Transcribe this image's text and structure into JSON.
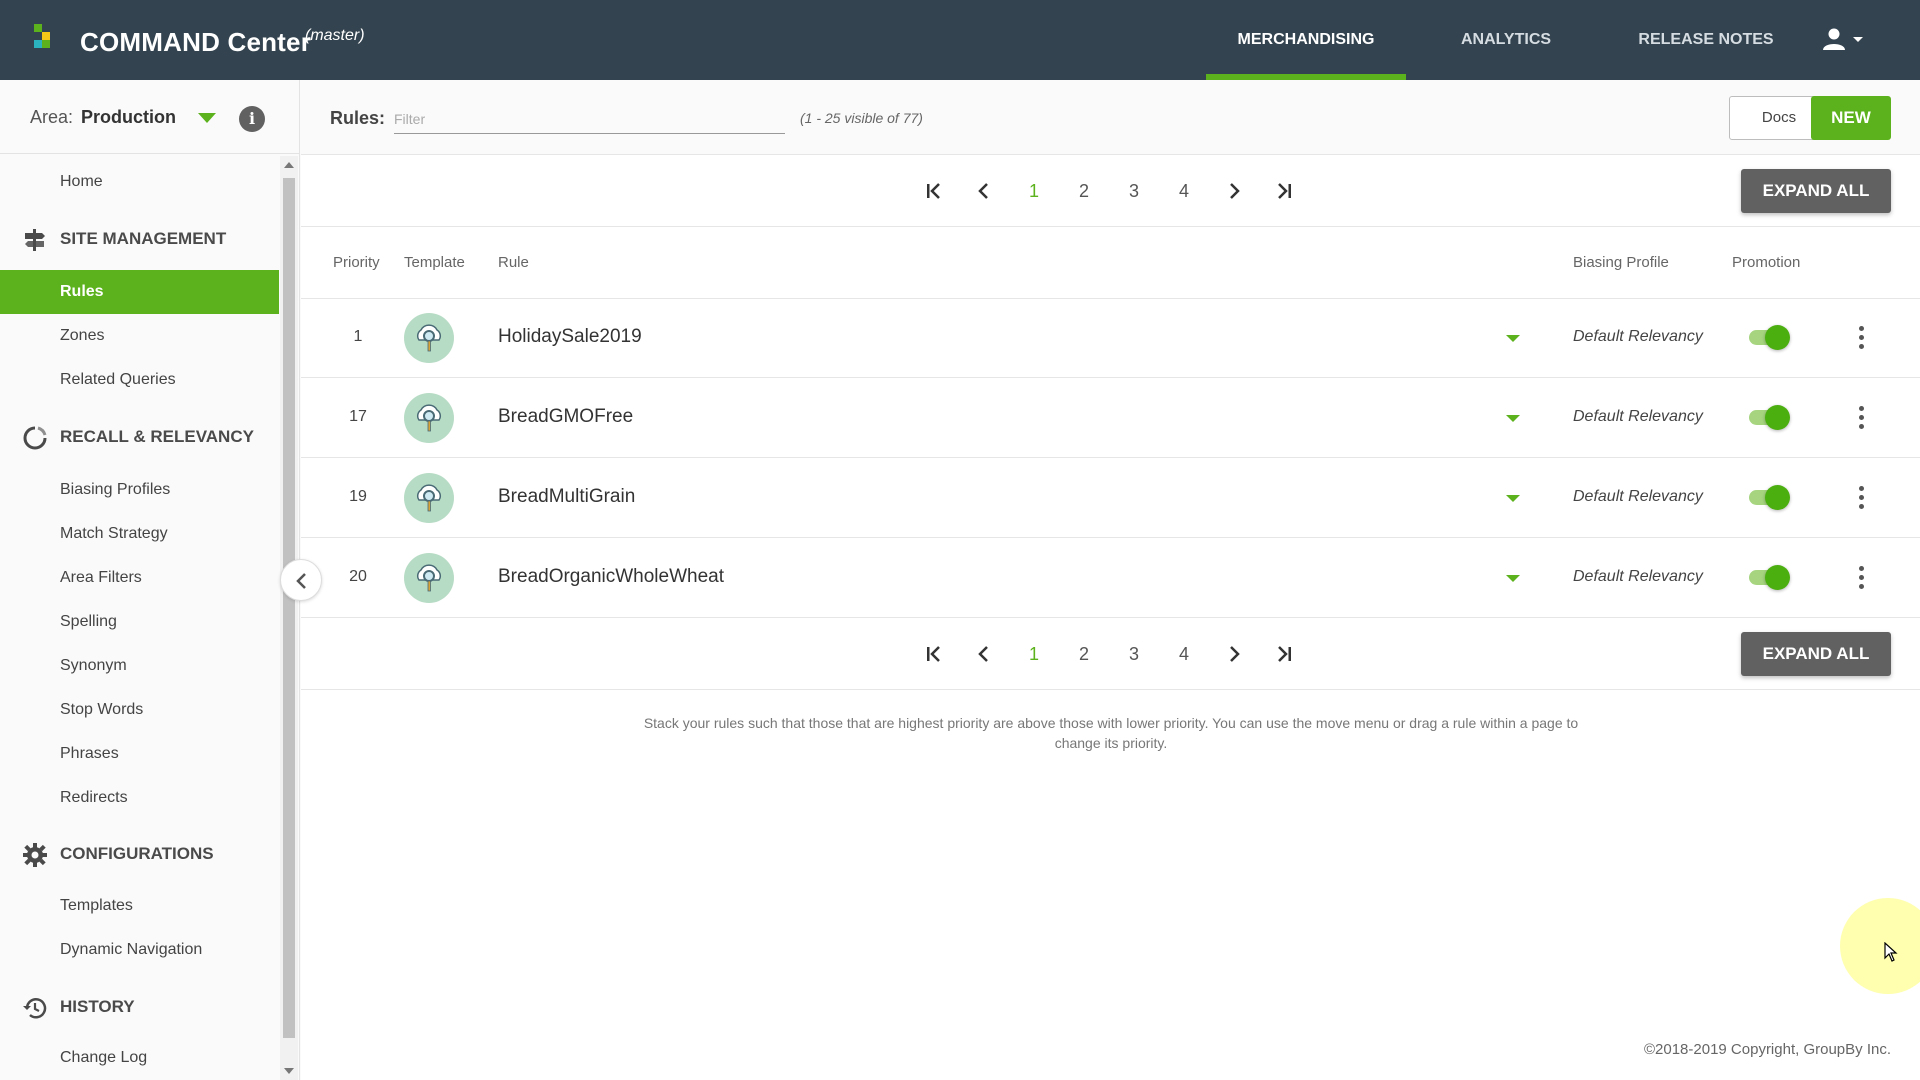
{
  "app": {
    "title": "COMMAND Center",
    "branch": "(master)",
    "brand_colors": {
      "header_bg": "#33434f",
      "accent": "#5cb21c"
    }
  },
  "nav": {
    "tabs": [
      {
        "label": "MERCHANDISING",
        "active": true
      },
      {
        "label": "ANALYTICS",
        "active": false
      },
      {
        "label": "RELEASE NOTES",
        "active": false
      }
    ],
    "user_icon": "user-icon"
  },
  "sidebar": {
    "area_label": "Area:",
    "area_value": "Production",
    "home": "Home",
    "sections": [
      {
        "title": "SITE MANAGEMENT",
        "icon": "signpost-icon",
        "items": [
          "Rules",
          "Zones",
          "Related Queries"
        ]
      },
      {
        "title": "RECALL & RELEVANCY",
        "icon": "circle-refresh-icon",
        "items": [
          "Biasing Profiles",
          "Match Strategy",
          "Area Filters",
          "Spelling",
          "Synonym",
          "Stop Words",
          "Phrases",
          "Redirects"
        ]
      },
      {
        "title": "CONFIGURATIONS",
        "icon": "gear-icon",
        "items": [
          "Templates",
          "Dynamic Navigation"
        ]
      },
      {
        "title": "HISTORY",
        "icon": "history-icon",
        "items": [
          "Change Log"
        ]
      }
    ],
    "active_item": "Rules"
  },
  "rules": {
    "label": "Rules:",
    "filter_placeholder": "Filter",
    "visible_count": "(1 - 25 visible of 77)",
    "docs_label": "Docs",
    "new_label": "NEW",
    "expand_all_label": "EXPAND ALL",
    "pagination": {
      "pages": [
        "1",
        "2",
        "3",
        "4"
      ],
      "current": "1"
    },
    "columns": [
      "Priority",
      "Template",
      "Rule",
      "Biasing Profile",
      "Promotion"
    ],
    "rows": [
      {
        "priority": "1",
        "name": "HolidaySale2019",
        "biasing": "Default Relevancy",
        "promotion": true
      },
      {
        "priority": "17",
        "name": "BreadGMOFree",
        "biasing": "Default Relevancy",
        "promotion": true
      },
      {
        "priority": "19",
        "name": "BreadMultiGrain",
        "biasing": "Default Relevancy",
        "promotion": true
      },
      {
        "priority": "20",
        "name": "BreadOrganicWholeWheat",
        "biasing": "Default Relevancy",
        "promotion": true
      }
    ],
    "help_text": "Stack your rules such that those that are highest priority are above those with lower priority. You can use the move menu or drag a rule within a page to change its priority."
  },
  "footer": {
    "copyright": "©2018-2019 Copyright, GroupBy Inc."
  }
}
